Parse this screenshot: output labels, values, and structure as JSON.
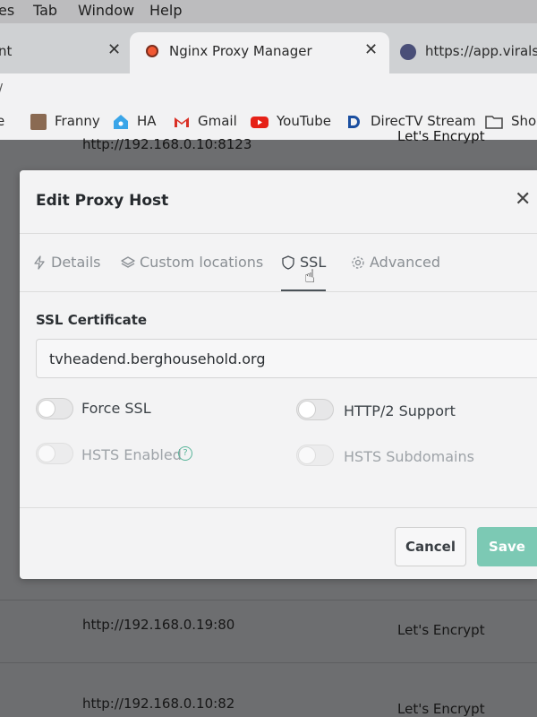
{
  "menubar": {
    "items": [
      "es",
      "Tab",
      "Window",
      "Help"
    ]
  },
  "browser": {
    "tabs": [
      {
        "title": "nt"
      },
      {
        "title": "Nginx Proxy Manager"
      },
      {
        "title": "https://app.viralsw"
      }
    ],
    "address_fragment": "/",
    "bookmarks": [
      "Franny",
      "HA",
      "Gmail",
      "YouTube",
      "DirecTV Stream",
      "Shop"
    ]
  },
  "background_rows": [
    {
      "url": "http://192.168.0.10:8123",
      "ssl": "Let's Encrypt"
    },
    {
      "url": "http://192.168.0.19:80",
      "ssl": "Let's Encrypt"
    },
    {
      "url": "http://192.168.0.10:82",
      "ssl": "Let's Encrypt"
    }
  ],
  "modal": {
    "title": "Edit Proxy Host",
    "tabs": [
      "Details",
      "Custom locations",
      "SSL",
      "Advanced"
    ],
    "active_tab": "SSL",
    "ssl_certificate_label": "SSL Certificate",
    "ssl_certificate_value": "tvheadend.berghousehold.org",
    "toggles": [
      {
        "label": "Force SSL",
        "on": false,
        "disabled": false
      },
      {
        "label": "HTTP/2 Support",
        "on": false,
        "disabled": false
      },
      {
        "label": "HSTS Enabled",
        "on": false,
        "disabled": true
      },
      {
        "label": "HSTS Subdomains",
        "on": false,
        "disabled": true
      }
    ],
    "cancel_label": "Cancel",
    "save_label": "Save"
  },
  "colors": {
    "accent": "#7cc9b4",
    "help_icon": "#59b59a"
  }
}
